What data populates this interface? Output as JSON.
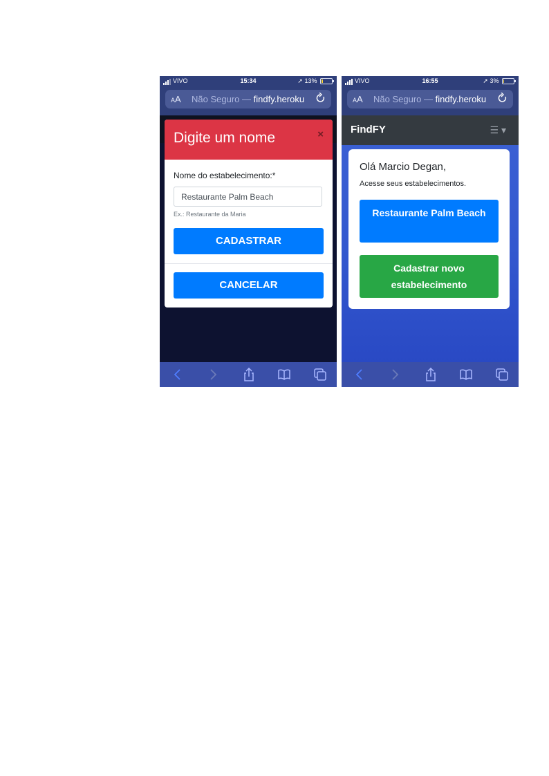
{
  "left_screen": {
    "status": {
      "carrier": "VIVO",
      "time": "15:34",
      "battery": "13%",
      "battery_level": 0.13,
      "battery_color": "#f7d33a"
    },
    "urlbar": {
      "aa": "AA",
      "prefix": "Não Seguro —",
      "domain": "findfy.heroku"
    },
    "modal": {
      "title": "Digite um nome",
      "close": "×",
      "label": "Nome do estabelecimento:*",
      "input_value": "Restaurante Palm Beach",
      "help": "Ex.: Restaurante da Maria",
      "submit_label": "CADASTRAR",
      "cancel_label": "CANCELAR"
    }
  },
  "right_screen": {
    "status": {
      "carrier": "VIVO",
      "time": "16:55",
      "battery": "3%",
      "battery_level": 0.03,
      "battery_color": "#f7d33a"
    },
    "urlbar": {
      "aa": "AA",
      "prefix": "Não Seguro —",
      "domain": "findfy.heroku"
    },
    "navbar": {
      "brand": "FindFY",
      "menu_icon": "hamburger-dropdown-icon"
    },
    "card": {
      "greeting": "Olá Marcio Degan,",
      "subtext": "Acesse seus estabelecimentos.",
      "establishment_label": "Restaurante Palm Beach",
      "new_label": "Cadastrar novo estabelecimento"
    }
  },
  "toolbar_icons": [
    "back-icon",
    "forward-icon",
    "share-icon",
    "bookmarks-icon",
    "tabs-icon"
  ],
  "colors": {
    "danger": "#dc3545",
    "primary": "#007bff",
    "success": "#28a745",
    "navbar": "#343a40"
  }
}
